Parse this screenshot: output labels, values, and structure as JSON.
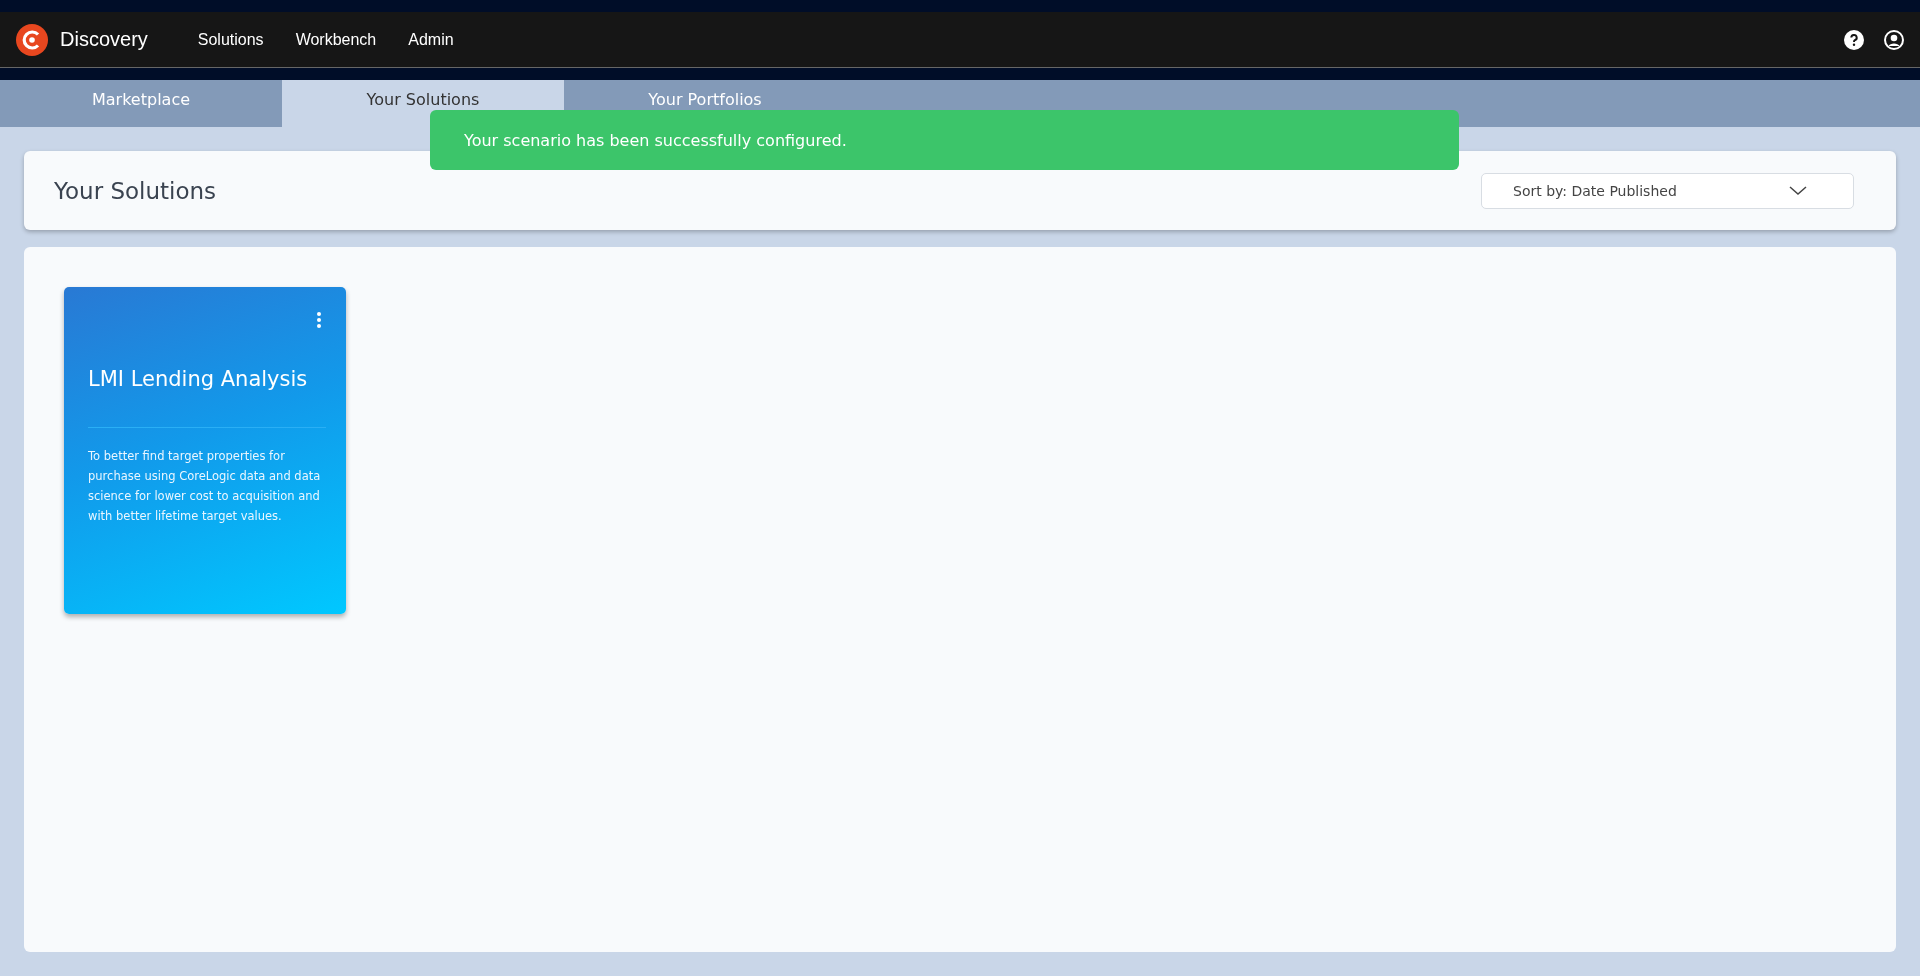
{
  "app": {
    "name": "Discovery"
  },
  "nav": [
    {
      "label": "Solutions"
    },
    {
      "label": "Workbench"
    },
    {
      "label": "Admin"
    }
  ],
  "tabs": [
    {
      "label": "Marketplace",
      "selected": false
    },
    {
      "label": "Your Solutions",
      "selected": true
    },
    {
      "label": "Your Portfolios",
      "selected": false
    }
  ],
  "toast": {
    "message": "Your scenario has been successfully configured."
  },
  "header": {
    "title": "Your Solutions",
    "sort": "Sort by: Date Published"
  },
  "solutions": [
    {
      "title": "LMI Lending Analysis",
      "description": "To better find target properties for purchase  using CoreLogic data and data science for lower cost to acquisition and with better lifetime target values."
    }
  ]
}
